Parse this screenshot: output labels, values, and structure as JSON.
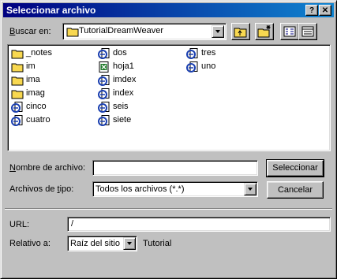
{
  "window": {
    "title": "Seleccionar archivo",
    "help_glyph": "?",
    "close_glyph": "✕"
  },
  "lookin": {
    "label_pre": "",
    "label_key": "B",
    "label_post": "uscar en:",
    "value": "TutorialDreamWeaver",
    "icon": "folder-icon"
  },
  "toolbar": {
    "up_icon": "up-folder-icon",
    "newfolder_icon": "new-folder-icon",
    "list_icon": "list-view-icon",
    "details_icon": "details-view-icon"
  },
  "files": [
    {
      "name": "_notes",
      "icon": "folder"
    },
    {
      "name": "im",
      "icon": "folder"
    },
    {
      "name": "ima",
      "icon": "folder"
    },
    {
      "name": "imag",
      "icon": "folder"
    },
    {
      "name": "cinco",
      "icon": "html"
    },
    {
      "name": "cuatro",
      "icon": "html"
    },
    {
      "name": "dos",
      "icon": "html"
    },
    {
      "name": "hoja1",
      "icon": "excel"
    },
    {
      "name": "imdex",
      "icon": "html"
    },
    {
      "name": "index",
      "icon": "html"
    },
    {
      "name": "seis",
      "icon": "html"
    },
    {
      "name": "siete",
      "icon": "html"
    },
    {
      "name": "tres",
      "icon": "html"
    },
    {
      "name": "uno",
      "icon": "html"
    }
  ],
  "filename": {
    "label_key": "N",
    "label_post": "ombre de archivo:",
    "value": ""
  },
  "filetype": {
    "label_pre": "Archivos de ",
    "label_key": "t",
    "label_post": "ipo:",
    "value": "Todos los archivos (*.*)"
  },
  "buttons": {
    "select": "Seleccionar",
    "cancel": "Cancelar"
  },
  "url": {
    "label": "URL:",
    "value": "/"
  },
  "relative": {
    "label": "Relativo a:",
    "value": "Raíz del sitio",
    "note": "Tutorial"
  },
  "colors": {
    "title_start": "#000080",
    "title_end": "#1084d0",
    "face": "#c0c0c0",
    "folder": "#f8d850",
    "html_icon": "#1a3fb0",
    "excel_icon": "#1f7a2a"
  }
}
